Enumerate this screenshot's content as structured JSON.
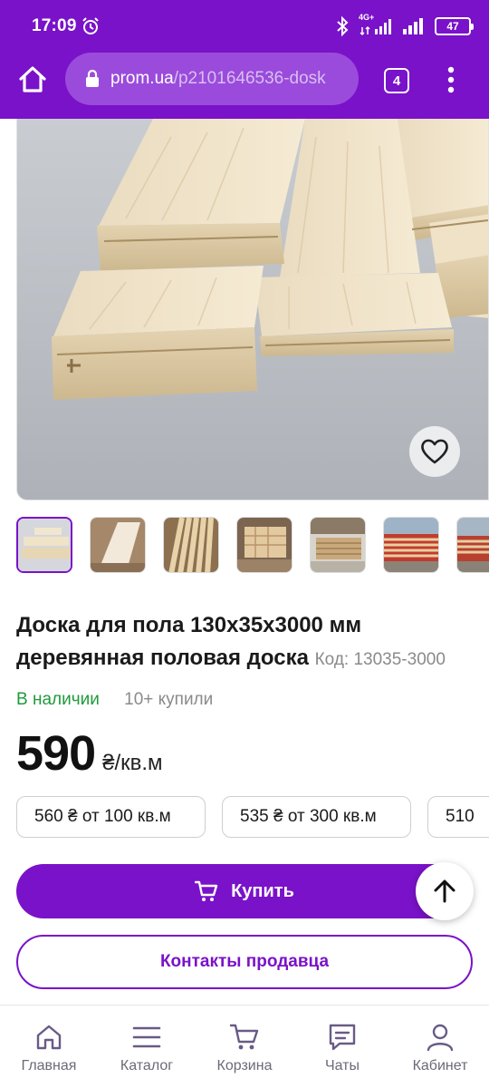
{
  "status_bar": {
    "time": "17:09",
    "network": "4G+",
    "battery": "47"
  },
  "browser": {
    "url_host": "prom.ua",
    "url_path": "/p2101646536-dosk",
    "tab_count": "4"
  },
  "product": {
    "title": "Доска для пола 130х35х3000 мм деревянная половая доска",
    "code": "Код: 13035-3000",
    "availability": "В наличии",
    "bought": "10+ купили",
    "price": "590",
    "unit": "₴/кв.м",
    "wholesale": [
      "560 ₴ от 100 кв.м",
      "535 ₴ от 300 кв.м",
      "510"
    ]
  },
  "actions": {
    "buy_label": "Купить",
    "contact_label": "Контакты продавца"
  },
  "bottom_nav": {
    "items": [
      {
        "label": "Главная",
        "icon": "home-icon"
      },
      {
        "label": "Каталог",
        "icon": "menu-icon"
      },
      {
        "label": "Корзина",
        "icon": "cart-icon"
      },
      {
        "label": "Чаты",
        "icon": "chat-icon"
      },
      {
        "label": "Кабинет",
        "icon": "user-icon"
      }
    ]
  },
  "colors": {
    "brand": "#7a12c9",
    "in_stock": "#1f9a3c"
  }
}
